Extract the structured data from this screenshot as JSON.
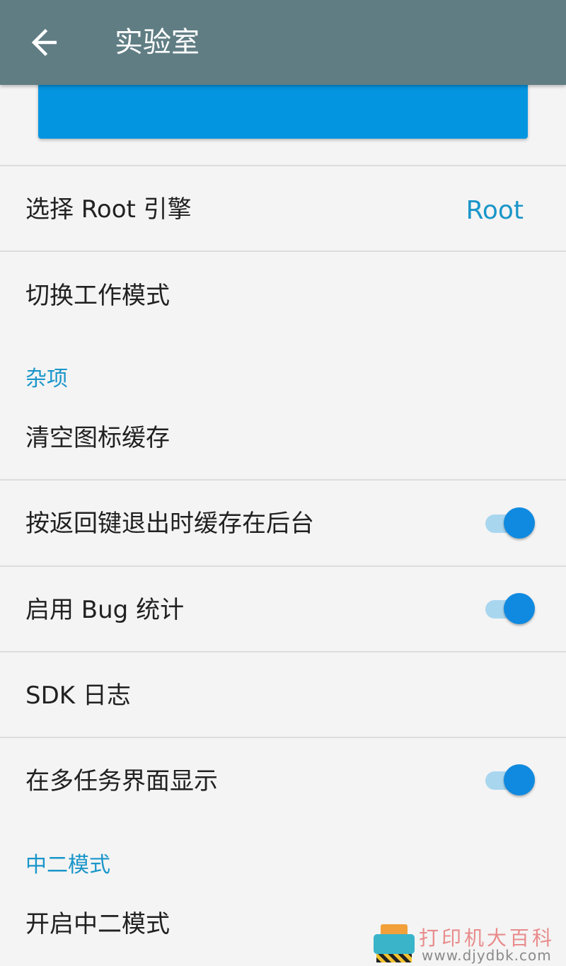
{
  "appbar": {
    "title": "实验室",
    "back_icon": "arrow-left-icon",
    "color": "#607d84"
  },
  "banner": {
    "color": "#0495e0"
  },
  "rows": {
    "root_engine": {
      "label": "选择 Root 引擎",
      "value": "Root"
    },
    "switch_mode": {
      "label": "切换工作模式"
    },
    "clear_icon_cache": {
      "label": "清空图标缓存"
    },
    "cache_on_back": {
      "label": "按返回键退出时缓存在后台",
      "enabled": true
    },
    "bug_stats": {
      "label": "启用 Bug 统计",
      "enabled": true
    },
    "sdk_log": {
      "label": "SDK 日志"
    },
    "show_in_recents": {
      "label": "在多任务界面显示",
      "enabled": true
    },
    "chuuni_mode": {
      "label": "开启中二模式"
    }
  },
  "sections": {
    "misc": "杂项",
    "chuuni": "中二模式"
  },
  "watermark": {
    "line1": "打印机大百科",
    "line2": "www.djydbk.com"
  },
  "colors": {
    "accent": "#1a96c9",
    "toggle_on": "#0f8ae0",
    "toggle_track": "#a9d6ef",
    "background": "#f4f4f4"
  }
}
